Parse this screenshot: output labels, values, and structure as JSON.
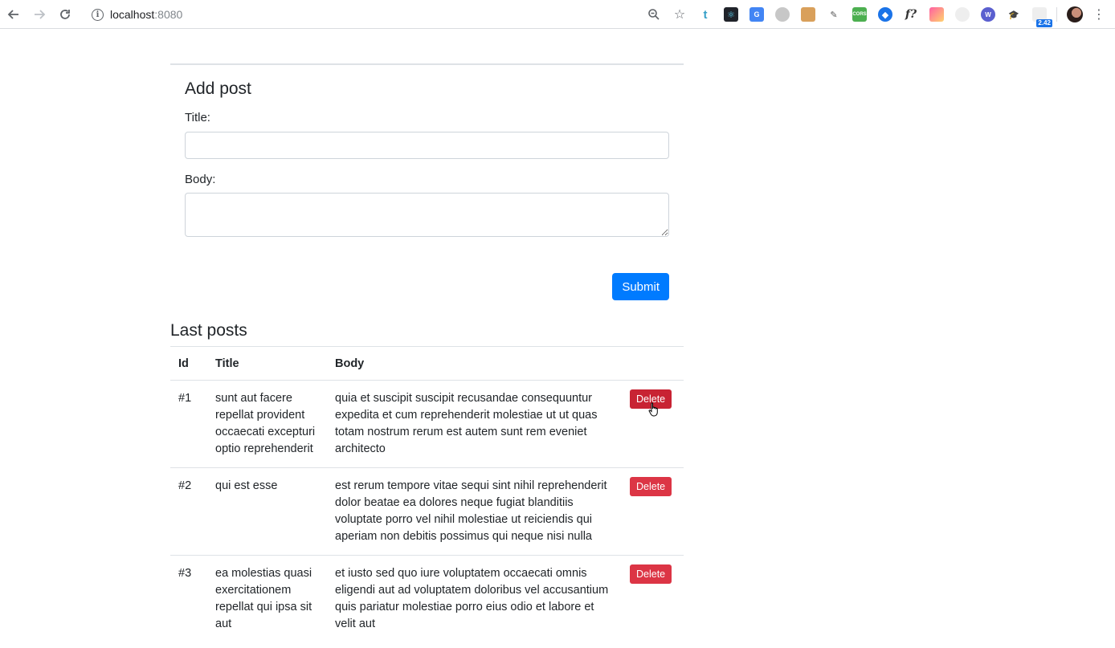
{
  "browser": {
    "host": "localhost",
    "port": ":8080",
    "extension_badge": "2.42",
    "colors": {
      "accent": "#1a73e8"
    }
  },
  "form": {
    "heading": "Add post",
    "title_label": "Title:",
    "title_value": "",
    "body_label": "Body:",
    "body_value": "",
    "submit_label": "Submit"
  },
  "posts": {
    "heading": "Last posts",
    "columns": {
      "id": "Id",
      "title": "Title",
      "body": "Body"
    },
    "delete_label": "Delete",
    "rows": [
      {
        "id": "#1",
        "title": "sunt aut facere repellat provident occaecati excepturi optio reprehenderit",
        "body": "quia et suscipit suscipit recusandae consequuntur expedita et cum reprehenderit molestiae ut ut quas totam nostrum rerum est autem sunt rem eveniet architecto"
      },
      {
        "id": "#2",
        "title": "qui est esse",
        "body": "est rerum tempore vitae sequi sint nihil reprehenderit dolor beatae ea dolores neque fugiat blanditiis voluptate porro vel nihil molestiae ut reiciendis qui aperiam non debitis possimus qui neque nisi nulla"
      },
      {
        "id": "#3",
        "title": "ea molestias quasi exercitationem repellat qui ipsa sit aut",
        "body": "et iusto sed quo iure voluptatem occaecati omnis eligendi aut ad voluptatem doloribus vel accusantium quis pariatur molestiae porro eius odio et labore et velit aut"
      }
    ]
  },
  "colors": {
    "primary": "#007bff",
    "danger": "#dc3545",
    "danger_hover": "#c82333",
    "border": "#dee2e6"
  }
}
